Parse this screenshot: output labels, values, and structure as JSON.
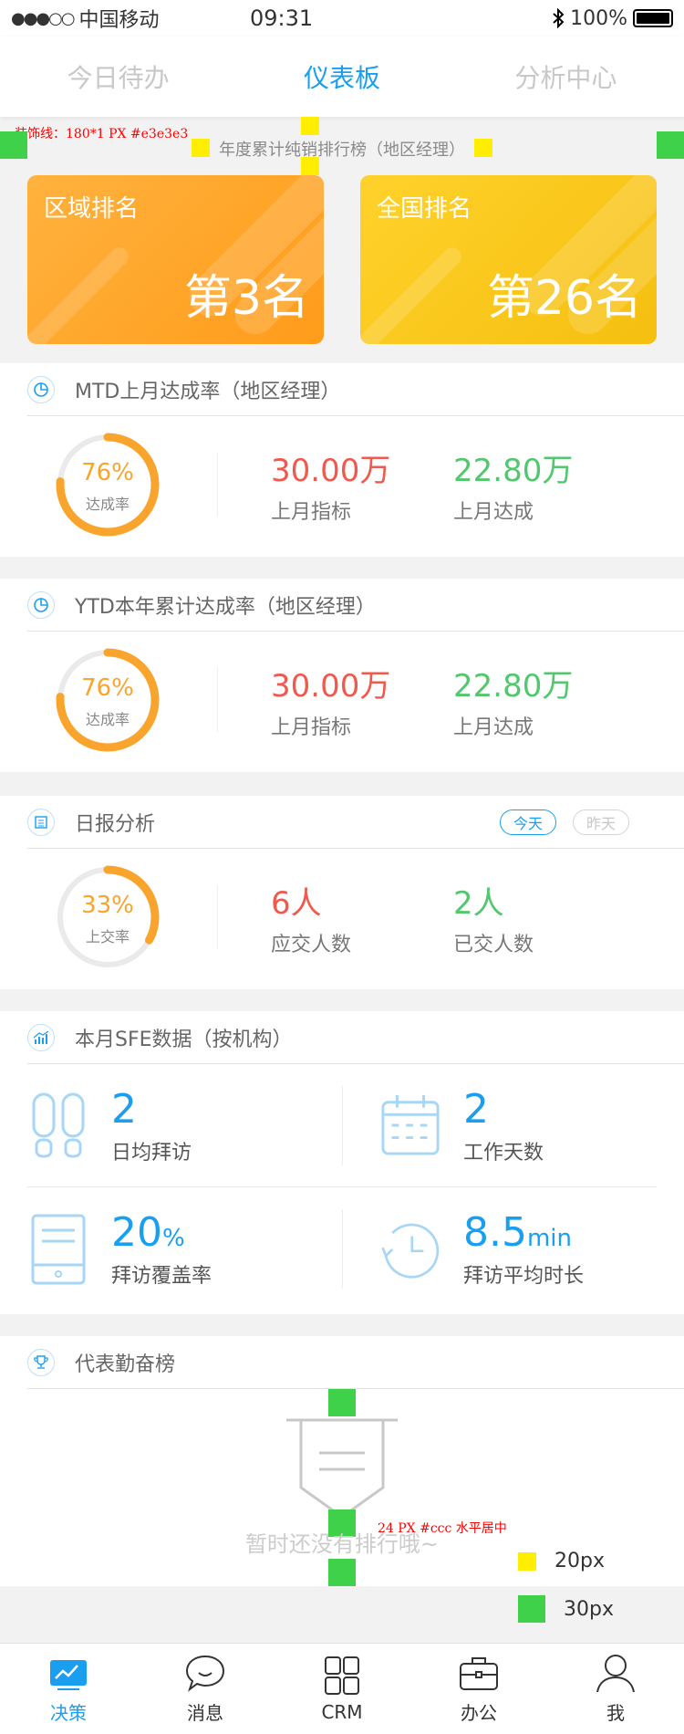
{
  "status_bar": {
    "signal": "●●●○○",
    "carrier": "中国移动",
    "time": "09:31",
    "bluetooth": "bluetooth-icon",
    "battery_pct": "100%"
  },
  "top_tabs": [
    {
      "label": "今日待办",
      "active": false
    },
    {
      "label": "仪表板",
      "active": true
    },
    {
      "label": "分析中心",
      "active": false
    }
  ],
  "annotations": {
    "decor_line": "装饰线：180*1 PX  #e3e3e3",
    "empty_note": "24 PX  #ccc 水平居中",
    "legend_yellow": "20px",
    "legend_green": "30px",
    "colors": {
      "yellow": "#ffee00",
      "green": "#3fd14a"
    }
  },
  "ranking": {
    "title": "年度累计纯销排行榜（地区经理）",
    "regional": {
      "label": "区域排名",
      "value": "第3名",
      "color": "#ffa72c"
    },
    "national": {
      "label": "全国排名",
      "value": "第26名",
      "color": "#f7c51a"
    }
  },
  "mtd": {
    "title": "MTD上月达成率（地区经理）",
    "icon": "pie-chart-icon",
    "rate_pct": "76%",
    "rate_value": 0.76,
    "rate_label": "达成率",
    "target_value": "30.00万",
    "target_label": "上月指标",
    "achieved_value": "22.80万",
    "achieved_label": "上月达成"
  },
  "ytd": {
    "title": "YTD本年累计达成率（地区经理）",
    "icon": "pie-chart-icon",
    "rate_pct": "76%",
    "rate_value": 0.76,
    "rate_label": "达成率",
    "target_value": "30.00万",
    "target_label": "上月指标",
    "achieved_value": "22.80万",
    "achieved_label": "上月达成"
  },
  "daily": {
    "title": "日报分析",
    "icon": "calendar-icon",
    "today_label": "今天",
    "yesterday_label": "昨天",
    "rate_pct": "33%",
    "rate_value": 0.33,
    "rate_label": "上交率",
    "due_value": "6人",
    "due_label": "应交人数",
    "submitted_value": "2人",
    "submitted_label": "已交人数"
  },
  "sfe": {
    "title": "本月SFE数据（按机构）",
    "icon": "growth-chart-icon",
    "items": [
      {
        "icon": "footprints-icon",
        "value": "2",
        "unit": "",
        "label": "日均拜访"
      },
      {
        "icon": "calendar-icon",
        "value": "2",
        "unit": "",
        "label": "工作天数"
      },
      {
        "icon": "document-tablet-icon",
        "value": "20",
        "unit": "%",
        "label": "拜访覆盖率"
      },
      {
        "icon": "clock-icon",
        "value": "8.5",
        "unit": "min",
        "label": "拜访平均时长"
      }
    ]
  },
  "leaderboard": {
    "title": "代表勤奋榜",
    "icon": "trophy-icon",
    "empty_text": "暂时还没有排行哦~"
  },
  "bottom_nav": [
    {
      "label": "决策",
      "icon": "dashboard-icon",
      "active": true
    },
    {
      "label": "消息",
      "icon": "chat-bubble-icon",
      "active": false
    },
    {
      "label": "CRM",
      "icon": "grid-icon",
      "active": false
    },
    {
      "label": "办公",
      "icon": "briefcase-icon",
      "active": false
    },
    {
      "label": "我",
      "icon": "user-icon",
      "active": false
    }
  ]
}
